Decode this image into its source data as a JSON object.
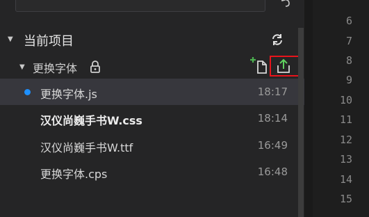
{
  "explorer": {
    "section_title": "当前项目",
    "folder": {
      "name": "更换字体"
    },
    "files": [
      {
        "name": "更换字体.js",
        "time": "18:17",
        "active": true,
        "modified": true
      },
      {
        "name": "汉仪尚巍手书W.css",
        "time": "18:14",
        "active": false,
        "bold": true
      },
      {
        "name": "汉仪尚巍手书W.ttf",
        "time": "16:49",
        "active": false
      },
      {
        "name": "更换字体.cps",
        "time": "16:48",
        "active": false
      }
    ]
  },
  "gutter": {
    "line_numbers": [
      "6",
      "7",
      "8",
      "9",
      "10",
      "11",
      "12",
      "13",
      "14",
      "15"
    ]
  },
  "icons": {
    "section_caret": "caret-down-icon",
    "refresh": "refresh-icon",
    "lock": "lock-icon",
    "new_file": "new-file-icon",
    "upload": "upload-icon"
  },
  "colors": {
    "highlight_border": "#e8141b",
    "modified_dot": "#1e90ff",
    "new_file_plus": "#4caf50",
    "upload_arrow": "#5fd05f"
  }
}
